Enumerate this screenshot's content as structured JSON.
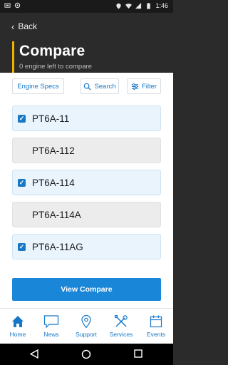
{
  "status_bar": {
    "time": "1:46"
  },
  "header": {
    "back_label": "Back",
    "title": "Compare",
    "subtitle": "0 engine left to compare"
  },
  "toolbar": {
    "engine_specs_label": "Engine Specs",
    "search_label": "Search",
    "filter_label": "Filter"
  },
  "engines": [
    {
      "name": "PT6A-11",
      "checked": true
    },
    {
      "name": "PT6A-112",
      "checked": false
    },
    {
      "name": "PT6A-114",
      "checked": true
    },
    {
      "name": "PT6A-114A",
      "checked": false
    },
    {
      "name": "PT6A-11AG",
      "checked": true
    }
  ],
  "view_compare_label": "View Compare",
  "tabs": [
    {
      "label": "Home",
      "icon": "home-icon"
    },
    {
      "label": "News",
      "icon": "news-icon"
    },
    {
      "label": "Support",
      "icon": "location-pin-icon"
    },
    {
      "label": "Services",
      "icon": "tools-icon"
    },
    {
      "label": "Events",
      "icon": "calendar-icon"
    }
  ],
  "colors": {
    "accent": "#1778c8",
    "title_bar": "#f0b400",
    "header_bg": "#2b2b2b",
    "checked_row": "#e9f4fd",
    "unchecked_row": "#ececec"
  }
}
